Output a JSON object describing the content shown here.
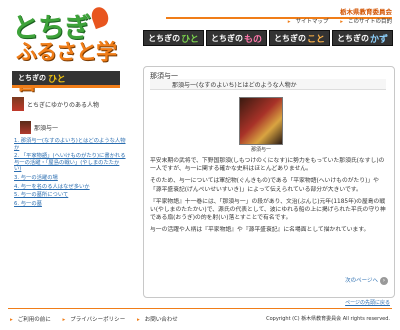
{
  "logo": {
    "line1": "とちぎ",
    "line2": "ふるさと学習"
  },
  "header": {
    "board": "栃木県教育委員会",
    "links": [
      "サイトマップ",
      "このサイトの目的"
    ]
  },
  "tabs": [
    {
      "prefix": "とちぎの",
      "word": "ひと"
    },
    {
      "prefix": "とちぎの",
      "word": "もの"
    },
    {
      "prefix": "とちぎの",
      "word": "こと"
    },
    {
      "prefix": "とちぎの",
      "word": "かず"
    }
  ],
  "sidebar": {
    "title_prefix": "とちぎの",
    "title_word": "ひと",
    "section": "とちぎにゆかりのある人物",
    "person": "那須与一",
    "links": [
      "1. 那須与一(なすのよいち)とはどのような人物か",
      "2. 「平家物語」(へいけものがたり)に書かれる与一の活躍・「屋島の戦い」(やしまのたたかい)",
      "3. 与一の活躍の場",
      "4. 与一を名のる人はなぜ多いか",
      "5. 与一の墓所について",
      "6. 与一の墓"
    ]
  },
  "panel": {
    "title": "那須与一",
    "subtitle": "那須与一(なすのよいち)とはどのような人物か",
    "caption": "那須与一",
    "paragraphs": [
      "平安末期の武将で、下野国那須(しもつけのくになす)に勢力をもっていた那須氏(なすし)の一人ですが、与一に関する確かな史料はほとんどありません。",
      "そのため、与一については軍記物(ぐんきもの)である「平家物語(へいけものがたり)」や「源平盛衰記(げんぺいせいすいき)」によって伝えられている部分が大きいです。",
      "『平家物語』十一巻には、「那須与一」の段があり、文治(ぶんじ)元年(1185年)の屋島の戦い(やしまのたたかい)で、源氏の代表として、波にゆれる船の上に掲げられた平氏の守り神である扇(おうぎ)の的を射(い)落とすことで有名です。",
      "与一の活躍や人柄は『平家物語』や『源平盛衰記』に名場面として描かれています。"
    ],
    "next": "次のページへ"
  },
  "totop": "ページの先頭に戻る",
  "footer": {
    "links": [
      "ご利用の前に",
      "プライバシーポリシー",
      "お問い合わせ"
    ],
    "copyright": "Copyright (C) 栃木県教育委員会 All rights reserved."
  }
}
